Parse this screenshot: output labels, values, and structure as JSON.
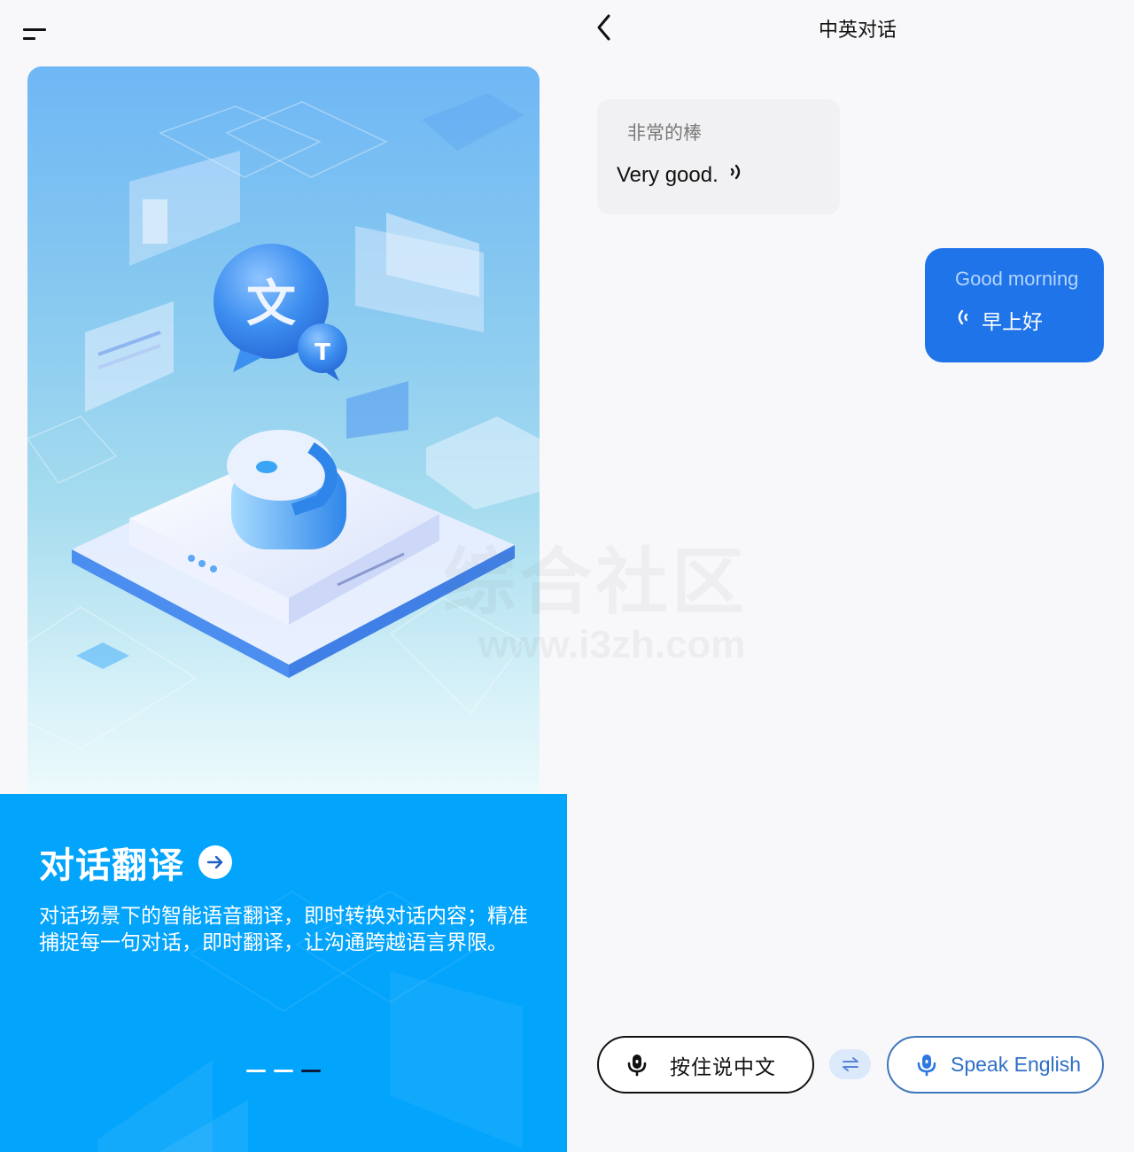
{
  "left": {
    "menu_icon": "menu-icon",
    "hero": {
      "icon_glyph_main": "文",
      "icon_glyph_secondary": "T"
    },
    "feature": {
      "title": "对话翻译",
      "arrow_icon": "arrow-right-circle-icon",
      "description": "对话场景下的智能语音翻译，即时转换对话内容；精准捕捉每一句对话，即时翻译，让沟通跨越语言界限。",
      "pager": {
        "total": 3,
        "active_index": 2
      }
    }
  },
  "watermark": {
    "text": "i3综合社区",
    "visible_text": "综合社区",
    "url": "www.i3zh.com"
  },
  "right": {
    "header": {
      "back_icon": "chevron-left-icon",
      "title": "中英对话"
    },
    "messages": [
      {
        "side": "left",
        "source": "非常的棒",
        "translation": "Very good.",
        "speaker_icon": "speaker-icon"
      },
      {
        "side": "right",
        "source": "Good morning",
        "translation": "早上好",
        "speaker_icon": "speaker-icon"
      }
    ],
    "controls": {
      "chinese_button": {
        "label": "按住说中文",
        "icon": "microphone-icon"
      },
      "swap_button": {
        "icon": "swap-arrows-icon"
      },
      "english_button": {
        "label": "Speak English",
        "icon": "microphone-icon"
      }
    }
  },
  "colors": {
    "info_panel_bg": "#03a4fc",
    "outgoing_bubble": "#1f74ea",
    "incoming_bubble": "#f1f1f3",
    "english_accent": "#2f6fc6",
    "swap_bg": "#dce9fb",
    "pager_active": "#0c1a3a"
  }
}
